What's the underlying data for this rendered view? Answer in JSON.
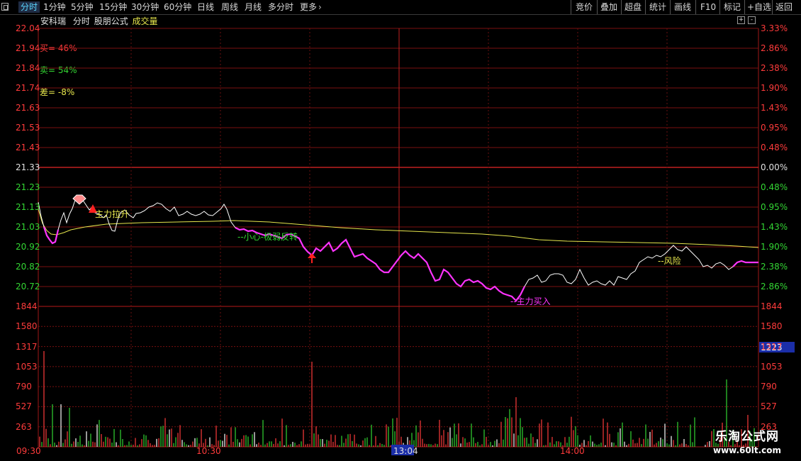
{
  "toolbar": {
    "periods": [
      "分时",
      "1分钟",
      "5分钟",
      "15分钟",
      "30分钟",
      "60分钟",
      "日线",
      "周线",
      "月线",
      "多分时",
      "更多"
    ],
    "active": "分时",
    "tools": [
      "竞价",
      "叠加",
      "超盘",
      "统计",
      "画线",
      "F10",
      "标记",
      "+自选",
      "返回"
    ]
  },
  "header": {
    "stock_name": "安科瑞",
    "mode": "分时",
    "formula": "股朋公式",
    "indicator": "成交量"
  },
  "stats": {
    "buy": "买= 46%",
    "sell": "卖= 54%",
    "diff": "差= -8%"
  },
  "annotations": {
    "pull_up": "主力拉升",
    "careful": "--小心-极弱反转",
    "buy_in": "--主力买入",
    "risk": "--风险"
  },
  "colors": {
    "up": "#ff3b3b",
    "down": "#33d633",
    "grid": "#7a1010",
    "price": "#ffffff",
    "avg": "#e6e64c",
    "weak": "#ff33ff"
  },
  "axes": {
    "price_ticks": [
      "22.04",
      "21.94",
      "21.84",
      "21.74",
      "21.63",
      "21.53",
      "21.43",
      "21.33",
      "21.23",
      "21.13",
      "21.03",
      "20.92",
      "20.82",
      "20.72"
    ],
    "pct_ticks": [
      "3.33%",
      "2.86%",
      "2.38%",
      "1.90%",
      "1.43%",
      "0.95%",
      "0.48%",
      "0.00%",
      "0.48%",
      "0.95%",
      "1.43%",
      "1.90%",
      "2.38%",
      "2.86%"
    ],
    "volume_ticks": [
      "1844",
      "1580",
      "1317",
      "1053",
      "790",
      "527",
      "263"
    ],
    "time_ticks": [
      "09:30",
      "10:30",
      "13:04",
      "14:00"
    ],
    "cursor_time": "13:04",
    "cursor_volume": "1223"
  },
  "watermark": {
    "line1": "乐淘公式网",
    "line2": "www.60lt.com"
  }
}
